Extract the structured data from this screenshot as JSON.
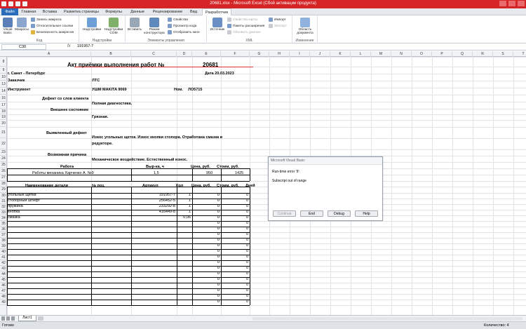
{
  "window": {
    "title": "20681.xlsx - Microsoft Excel (Сбой активации продукта)"
  },
  "tabs": [
    "Файл",
    "Главная",
    "Вставка",
    "Разметка страницы",
    "Формулы",
    "Данные",
    "Рецензирование",
    "Вид",
    "Разработчик"
  ],
  "ribbon": {
    "code": {
      "label": "Код",
      "visual_basic": "Visual Basic",
      "macros": "Макросы",
      "record": "Запись макроса",
      "relative": "Относительные ссылки",
      "security": "Безопасность макросов"
    },
    "addins": {
      "label": "Надстройки",
      "addins": "Надстройки",
      "com": "Надстройки COM"
    },
    "controls": {
      "label": "Элементы управления",
      "insert": "Вставить",
      "design": "Режим конструктора",
      "properties": "Свойства",
      "view_code": "Просмотр кода",
      "show_window": "Отобразить окно"
    },
    "xml": {
      "label": "XML",
      "source": "Источник",
      "map_props": "Свойства карты",
      "ext_packs": "Пакеты расширения",
      "refresh": "Обновить данные",
      "import": "Импорт",
      "export": "Экспорт"
    },
    "modify": {
      "label": "Изменение",
      "doc_panel": "Область документа"
    }
  },
  "formula_bar": {
    "name_box": "C30",
    "fx": "fx",
    "value": "191957-7"
  },
  "columns": [
    "A",
    "B",
    "C",
    "D",
    "E",
    "F",
    "G",
    "H",
    "I",
    "J",
    "K",
    "L",
    "M",
    "N",
    "O",
    "P",
    "Q",
    "R",
    "S",
    "T"
  ],
  "rows": [
    "8",
    "9",
    "10",
    "13",
    "14",
    "16",
    "17",
    "18",
    "19",
    "20",
    "21",
    "22",
    "23",
    "24",
    "25",
    "26",
    "27",
    "28",
    "29",
    "30",
    "31",
    "32",
    "33",
    "34",
    "35",
    "36",
    "37",
    "38",
    "39",
    "40",
    "41",
    "42",
    "43",
    "44",
    "45",
    "46",
    "47",
    "48",
    "49"
  ],
  "sheet": {
    "title": "Акт приёмки выполнения работ  №",
    "number": "20681",
    "city": "г. Санкт - Петербург",
    "date": "Дата 20.03.2023",
    "customer_label": "Заказчик",
    "customer": "ЛТС",
    "tool_label": "Инструмент",
    "tool": "УШМ MAKITA 9069",
    "nom_label": "Ном.",
    "nom": "ЛО5715",
    "defect_label": "Дефект со слов клиента",
    "defect": "Полная диагностика.",
    "appearance_label": "Внешнее состояние",
    "appearance": "Грязная.",
    "found_label": "Выявленный дефект",
    "found_line1": "Износ угольных щеток. Износ кнопки стопора. Отработана смазка в",
    "found_line2": "редукторе.",
    "cause_label": "Возможная причина",
    "cause": "Механическое воздействие. Естественный износ.",
    "work_header": {
      "work": "Работа",
      "hours": "Выр-ка, ч",
      "price": "Цена, руб.",
      "cost": "Стоим, руб."
    },
    "work_row": {
      "work": "Работы механика Харченко А. №9",
      "hours": "1,5",
      "price": "950",
      "cost": "1425"
    },
    "parts_header": {
      "name": "Наименование детали",
      "pos": "№ поз.",
      "article": "Артикул",
      "qty": "Кол",
      "price": "Цена, руб.",
      "cost": "Стоим, руб.",
      "days": "Дней"
    },
    "parts": [
      {
        "name": "угольные щетки",
        "article": "191957-7",
        "qty": "1",
        "price": "0",
        "cost": "0"
      },
      {
        "name": "стопорный штифт",
        "article": "256452-5",
        "qty": "1",
        "price": "0",
        "cost": "0"
      },
      {
        "name": "пружина",
        "article": "233292-8",
        "qty": "1",
        "price": "0",
        "cost": "0"
      },
      {
        "name": "кнопка",
        "article": "416449-8",
        "qty": "1",
        "price": "0",
        "cost": "0"
      },
      {
        "name": "смазка",
        "article": "",
        "qty": "0,06",
        "price": "0",
        "cost": "0"
      }
    ],
    "empty_zero": "0"
  },
  "dialog": {
    "title": "Microsoft Visual Basic",
    "line1": "Run-time error '9':",
    "line2": "Subscript out of range",
    "buttons": [
      "Continue",
      "End",
      "Debug",
      "Help"
    ]
  },
  "sheet_tab": "Лист1",
  "status": {
    "state": "Готово",
    "count": "Количество: 4"
  }
}
